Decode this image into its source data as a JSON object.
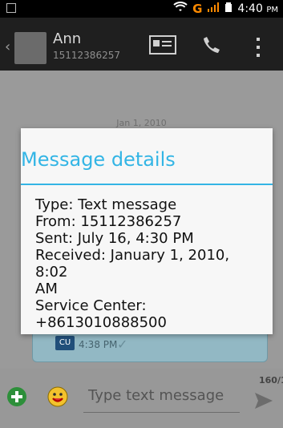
{
  "status_bar": {
    "time": "4:40",
    "time_period": "PM",
    "network": "G"
  },
  "header": {
    "contact_name": "Ann",
    "contact_number": "15112386257"
  },
  "chat": {
    "date_separator": "Jan 1, 2010",
    "message_time": "4:38 PM",
    "sim_label": "CU"
  },
  "composer": {
    "placeholder": "Type text message",
    "counter": "160/1"
  },
  "dialog": {
    "title": "Message details",
    "lines": [
      "Type: Text message",
      "From: 15112386257",
      "Sent: July 16, 4:30 PM",
      "Received: January 1, 2010, 8:02",
      "AM",
      "Service Center:",
      "+8613010888500"
    ]
  },
  "colors": {
    "accent": "#33b5e5",
    "dialog_bg": "#f7f7f7",
    "header_bg": "#1f1f1f",
    "bubble_bg": "#92b8c4"
  }
}
